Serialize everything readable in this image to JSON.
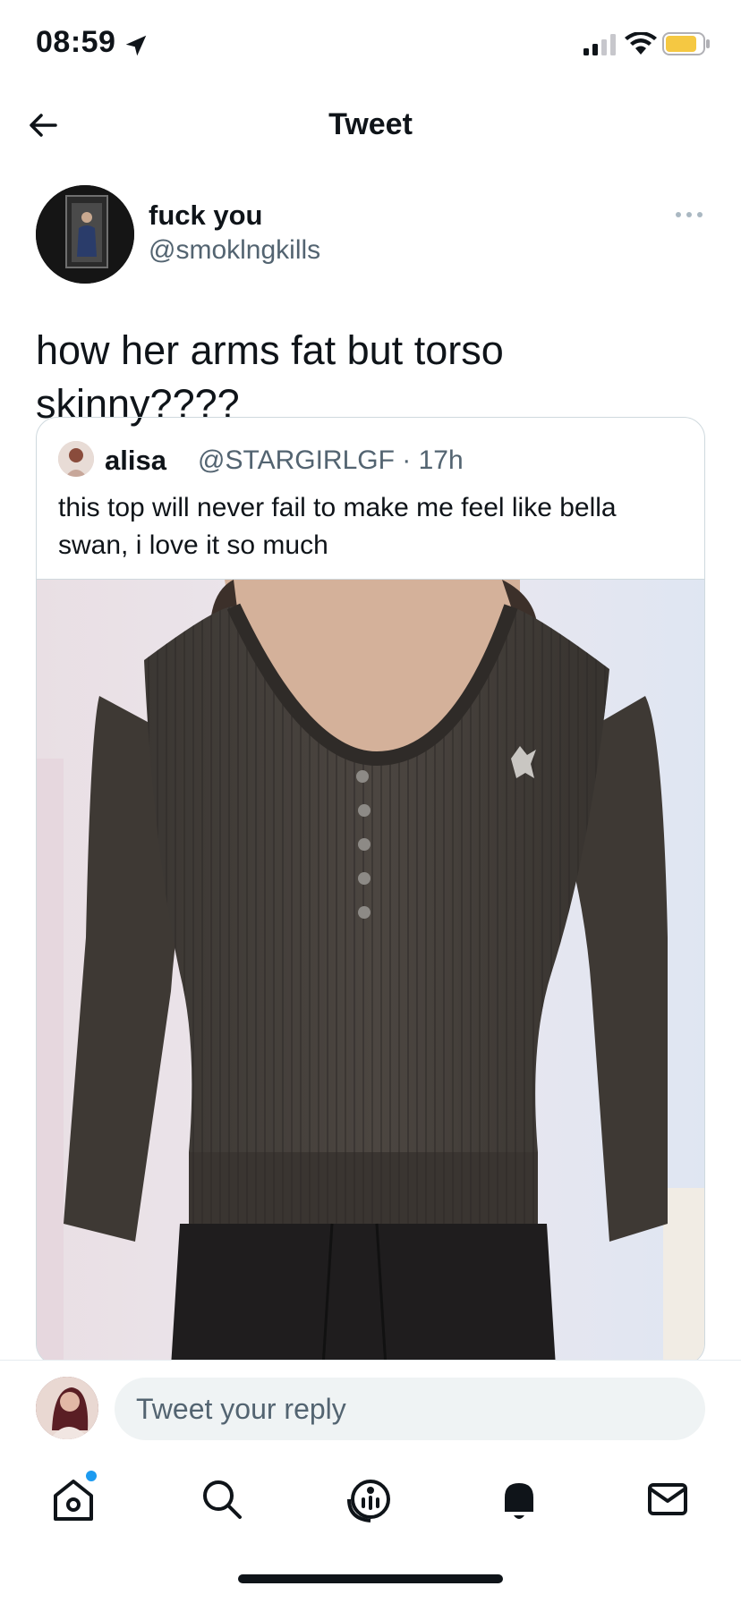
{
  "status_bar": {
    "time": "08:59",
    "battery_color": "#f5c842"
  },
  "header": {
    "title": "Tweet"
  },
  "tweet": {
    "author_name": "fuck you",
    "author_handle": "@smoklngkills",
    "text": "how her arms fat but torso skinny????"
  },
  "quoted_tweet": {
    "author_name": "alisa",
    "author_handle": "@STARGIRLGF · 17h",
    "text": "this top will never fail to make me feel like bella swan, i love it so much"
  },
  "reply": {
    "placeholder": "Tweet your reply"
  },
  "nav": {
    "items": [
      "home-icon",
      "search-icon",
      "spaces-icon",
      "notifications-icon",
      "messages-icon"
    ],
    "active": "home-icon",
    "badge_color": "#1d9bf0"
  },
  "colors": {
    "text_primary": "#0f1419",
    "text_secondary": "#536471",
    "border": "#cfd9de"
  }
}
